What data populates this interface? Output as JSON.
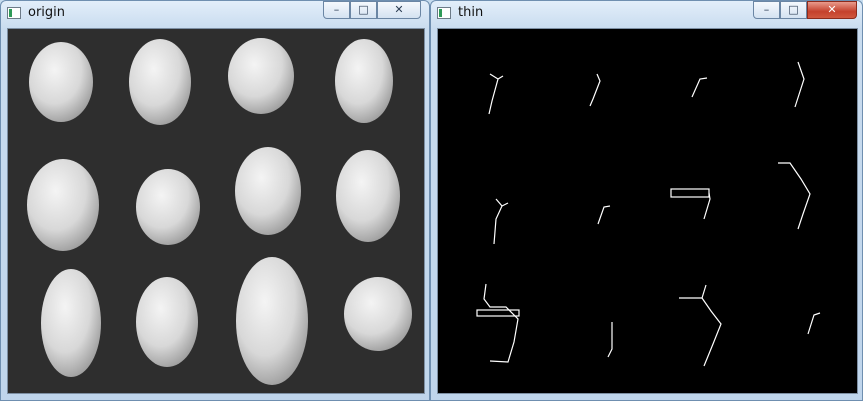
{
  "windows": {
    "origin": {
      "title": "origin",
      "image": "grayscale photo of 12 potatoes arranged in 3 rows of 4 on a dark background"
    },
    "thin": {
      "title": "thin",
      "image": "skeletonized (thinned) white line segments on black background"
    }
  },
  "controls": {
    "minimize_icon": "minimize-icon",
    "maximize_icon": "maximize-icon",
    "close_icon": "close-icon"
  },
  "colors": {
    "titlebar": "#c9dcef",
    "close_button": "#c4412c",
    "origin_bg": "#2e2e2e",
    "thin_bg": "#000000",
    "skeleton_line": "#ffffff"
  }
}
